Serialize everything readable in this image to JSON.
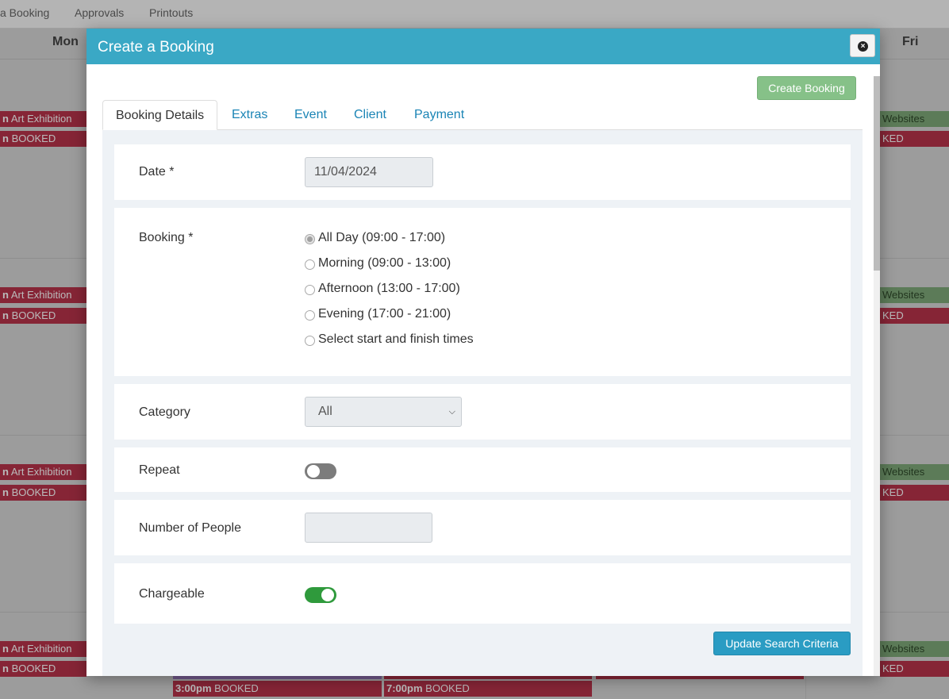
{
  "topnav": {
    "items": [
      {
        "label": "a Booking"
      },
      {
        "label": "Approvals"
      },
      {
        "label": "Printouts"
      }
    ]
  },
  "calendar": {
    "days": {
      "mon": "Mon",
      "fri": "Fri"
    },
    "mon_events": {
      "title_time": "n",
      "title": "Art Exhibition",
      "booked_time": "n",
      "booked": "BOOKED"
    },
    "fri_events": {
      "title": "Websites",
      "booked": "KED"
    },
    "bottom_events": [
      {
        "time": "3:00pm",
        "label": "BOOKED"
      },
      {
        "time": "7:00pm",
        "label": "BOOKED"
      }
    ],
    "colors": {
      "booked": "#b8334b",
      "websites": "#7fa979"
    }
  },
  "modal": {
    "title": "Create a Booking",
    "close_icon": "close-circle-icon",
    "create_button": "Create Booking",
    "tabs": [
      {
        "label": "Booking Details",
        "active": true
      },
      {
        "label": "Extras"
      },
      {
        "label": "Event"
      },
      {
        "label": "Client"
      },
      {
        "label": "Payment"
      }
    ],
    "form": {
      "date": {
        "label": "Date *",
        "value": "11/04/2024"
      },
      "booking": {
        "label": "Booking *",
        "options": [
          {
            "label": "All Day (09:00 - 17:00)",
            "checked": true
          },
          {
            "label": "Morning (09:00 - 13:00)",
            "checked": false
          },
          {
            "label": "Afternoon (13:00 - 17:00)",
            "checked": false
          },
          {
            "label": "Evening (17:00 - 21:00)",
            "checked": false
          },
          {
            "label": "Select start and finish times",
            "checked": false
          }
        ]
      },
      "category": {
        "label": "Category",
        "value": "All"
      },
      "repeat": {
        "label": "Repeat",
        "on": false
      },
      "people": {
        "label": "Number of People",
        "value": ""
      },
      "chargeable": {
        "label": "Chargeable",
        "on": true
      }
    },
    "update_button": "Update Search Criteria",
    "colors": {
      "header": "#3aa8c5",
      "create": "#86c188",
      "update": "#2a9cc3",
      "toggle_on": "#2f9a3c"
    }
  }
}
